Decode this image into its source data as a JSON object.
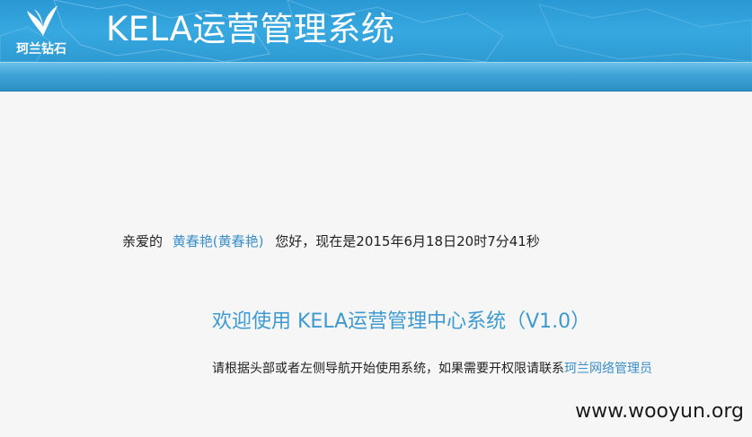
{
  "header": {
    "logo_text": "珂兰钻石",
    "app_title": "KELA运营管理系统"
  },
  "main": {
    "greeting_prefix": "亲爱的",
    "user_name": "黄春艳(黄春艳)",
    "greeting_suffix": "您好，现在是2015年6月18日20时7分41秒",
    "welcome_title": "欢迎使用 KELA运营管理中心系统（V1.0）",
    "instructions_text": "请根据头部或者左侧导航开始使用系统，如果需要开权限请联系",
    "admin_link": "珂兰网络管理员"
  },
  "watermark": "www.wooyun.org",
  "colors": {
    "header_blue": "#2f9ad2",
    "link_blue": "#3a8fc8",
    "welcome_blue": "#3d9ad0"
  }
}
